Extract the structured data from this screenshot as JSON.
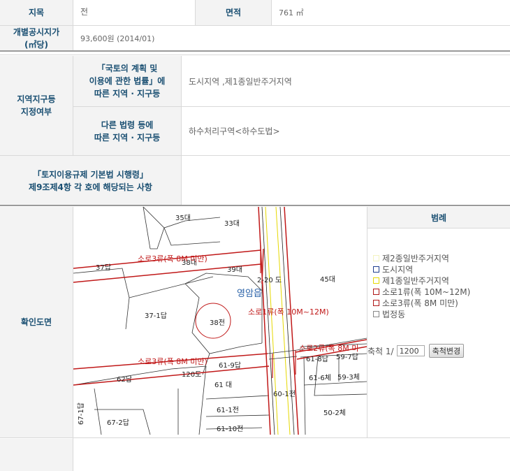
{
  "row1": {
    "label": "지목",
    "value": "전",
    "area_label": "면적",
    "area_value": "761 ㎡"
  },
  "row2": {
    "label_line1": "개별공시지가",
    "label_line2": "(㎡당)",
    "value": "93,600원 (2014/01)"
  },
  "zoning": {
    "label_line1": "지역지구등",
    "label_line2": "지정여부",
    "sub1_line1": "「국토의 계획 및",
    "sub1_line2": "이용에 관한 법률」에",
    "sub1_line3": "따른 지역 · 지구등",
    "sub1_value": "도시지역 ,제1종일반주거지역",
    "sub2_line1": "다른 법령 등에",
    "sub2_line2": "따른 지역 · 지구등",
    "sub2_value": "하수처리구역<하수도법>"
  },
  "regulation": {
    "line1": "「토지이용규제 기본법 시행령」",
    "line2": "제9조제4항 각 호에 해당되는 사항",
    "value": ""
  },
  "map_section": {
    "label": "확인도면"
  },
  "map_labels": {
    "p35": "35대",
    "p33": "33대",
    "p37": "37답",
    "p38d": "38대",
    "p39": "39대",
    "p220": "2-20 도",
    "p45": "45대",
    "district": "영암읍",
    "p371": "37-1답",
    "p38j": "38전",
    "road_a": "소로3류(폭 8M 미만)",
    "road_b": "소로1류(폭 10M~12M)",
    "road_c": "소로3류(폭 8M 미만)",
    "road_d": "소로2류(폭 8M 미",
    "p618": "61-8답",
    "p597": "59-7답",
    "p619": "61-9답",
    "p62": "62답",
    "p120": "120도",
    "p61": "61 대",
    "p616": "61-6체",
    "p593": "59-3체",
    "p601": "60-1전",
    "p611": "61-1전",
    "p502": "50-2체",
    "p672": "67-2답",
    "p6110": "61-10전",
    "p67_1": "67-1답"
  },
  "legend": {
    "title": "범례",
    "items": [
      {
        "label": "제2종일반주거지역",
        "color": "#f3f3c0"
      },
      {
        "label": "도시지역",
        "color": "#1f3f8f"
      },
      {
        "label": "제1종일반주거지역",
        "color": "#e6d800"
      },
      {
        "label": "소로1류(폭 10M~12M)",
        "color": "#b01818"
      },
      {
        "label": "소로3류(폭 8M 미만)",
        "color": "#b01818"
      },
      {
        "label": "법정동",
        "color": "#888888"
      }
    ]
  },
  "scale": {
    "label": "축척 1/",
    "value": "1200",
    "button": "축척변경"
  },
  "colors": {
    "header_text": "#1a4f72",
    "road_red": "#c01818"
  }
}
